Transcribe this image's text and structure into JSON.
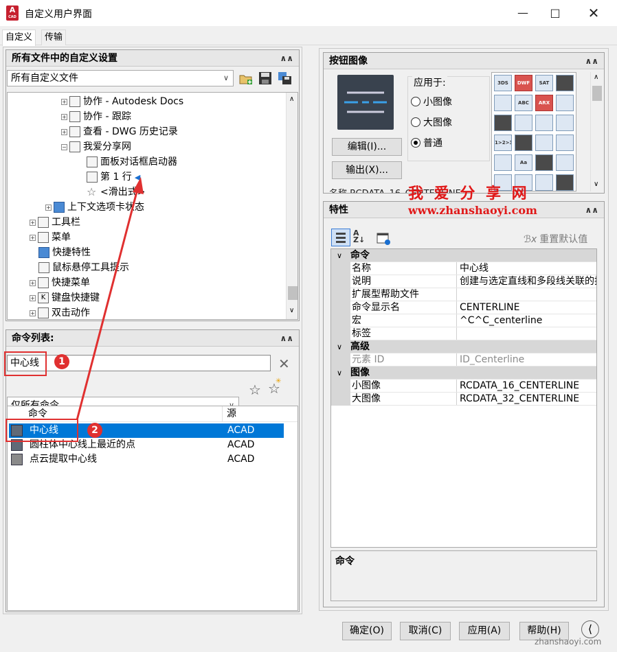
{
  "window": {
    "title": "自定义用户界面",
    "app_icon_letter": "A",
    "app_icon_sub": "CAD"
  },
  "tabs": [
    {
      "label": "自定义"
    },
    {
      "label": "传输"
    }
  ],
  "customizations_panel": {
    "title": "所有文件中的自定义设置",
    "combo_value": "所有自定义文件",
    "tree": [
      {
        "label": "协作 - Autodesk Docs"
      },
      {
        "label": "协作 - 跟踪"
      },
      {
        "label": "查看 - DWG 历史记录"
      },
      {
        "label": "我爱分享网"
      },
      {
        "label": "面板对话框启动器"
      },
      {
        "label": "第 1 行"
      },
      {
        "label": "<滑出式>"
      },
      {
        "label": "上下文选项卡状态"
      },
      {
        "label": "工具栏"
      },
      {
        "label": "菜单"
      },
      {
        "label": "快捷特性"
      },
      {
        "label": "鼠标悬停工具提示"
      },
      {
        "label": "快捷菜单"
      },
      {
        "label": "键盘快捷键"
      },
      {
        "label": "双击动作"
      }
    ]
  },
  "command_list_panel": {
    "title": "命令列表:",
    "search_value": "中心线",
    "filter_value": "仅所有命令",
    "columns": [
      "命令",
      "源"
    ],
    "rows": [
      {
        "name": "中心线",
        "source": "ACAD",
        "selected": true
      },
      {
        "name": "圆柱体中心线上最近的点",
        "source": "ACAD",
        "selected": false
      },
      {
        "name": "点云提取中心线",
        "source": "ACAD",
        "selected": false
      }
    ]
  },
  "button_image_panel": {
    "title": "按钮图像",
    "apply_to_label": "应用于:",
    "radios": [
      {
        "label": "小图像",
        "checked": false
      },
      {
        "label": "大图像",
        "checked": false
      },
      {
        "label": "普通",
        "checked": true
      }
    ],
    "edit_button": "编辑(I)...",
    "export_button": "输出(X)...",
    "icons": [
      "3DS",
      "DWF",
      "SAT",
      "",
      "",
      "ABC",
      "ARX",
      "",
      "",
      "",
      "",
      "",
      "1>2>3",
      "",
      "",
      "",
      "",
      "Aa",
      "",
      "",
      "",
      "",
      "",
      ""
    ],
    "partial_row": "名称   RCDATA_16_CENTERLINE"
  },
  "properties_panel": {
    "title": "特性",
    "reset_label": "重置默认值",
    "categories": [
      {
        "name": "命令",
        "rows": [
          {
            "name": "名称",
            "value": "中心线"
          },
          {
            "name": "说明",
            "value": "创建与选定直线和多段线关联的指"
          },
          {
            "name": "扩展型帮助文件",
            "value": ""
          },
          {
            "name": "命令显示名",
            "value": "CENTERLINE"
          },
          {
            "name": "宏",
            "value": "^C^C_centerline"
          },
          {
            "name": "标签",
            "value": ""
          }
        ]
      },
      {
        "name": "高级",
        "rows": [
          {
            "name": "元素 ID",
            "value": "ID_Centerline",
            "disabled": true
          }
        ]
      },
      {
        "name": "图像",
        "rows": [
          {
            "name": "小图像",
            "value": "RCDATA_16_CENTERLINE"
          },
          {
            "name": "大图像",
            "value": "RCDATA_32_CENTERLINE"
          }
        ]
      }
    ],
    "description_title": "命令"
  },
  "footer": {
    "ok": "确定(O)",
    "cancel": "取消(C)",
    "apply": "应用(A)",
    "help": "帮助(H)"
  },
  "watermark": {
    "title": "我 爱 分 享 网",
    "url": "www.zhanshaoyi.com",
    "corner": "zhanshaoyi.com"
  },
  "annotations": {
    "badge1": "1",
    "badge2": "2"
  },
  "colors": {
    "selection": "#0078d7",
    "annotation": "#e03030",
    "accent_red": "#c6202f"
  }
}
